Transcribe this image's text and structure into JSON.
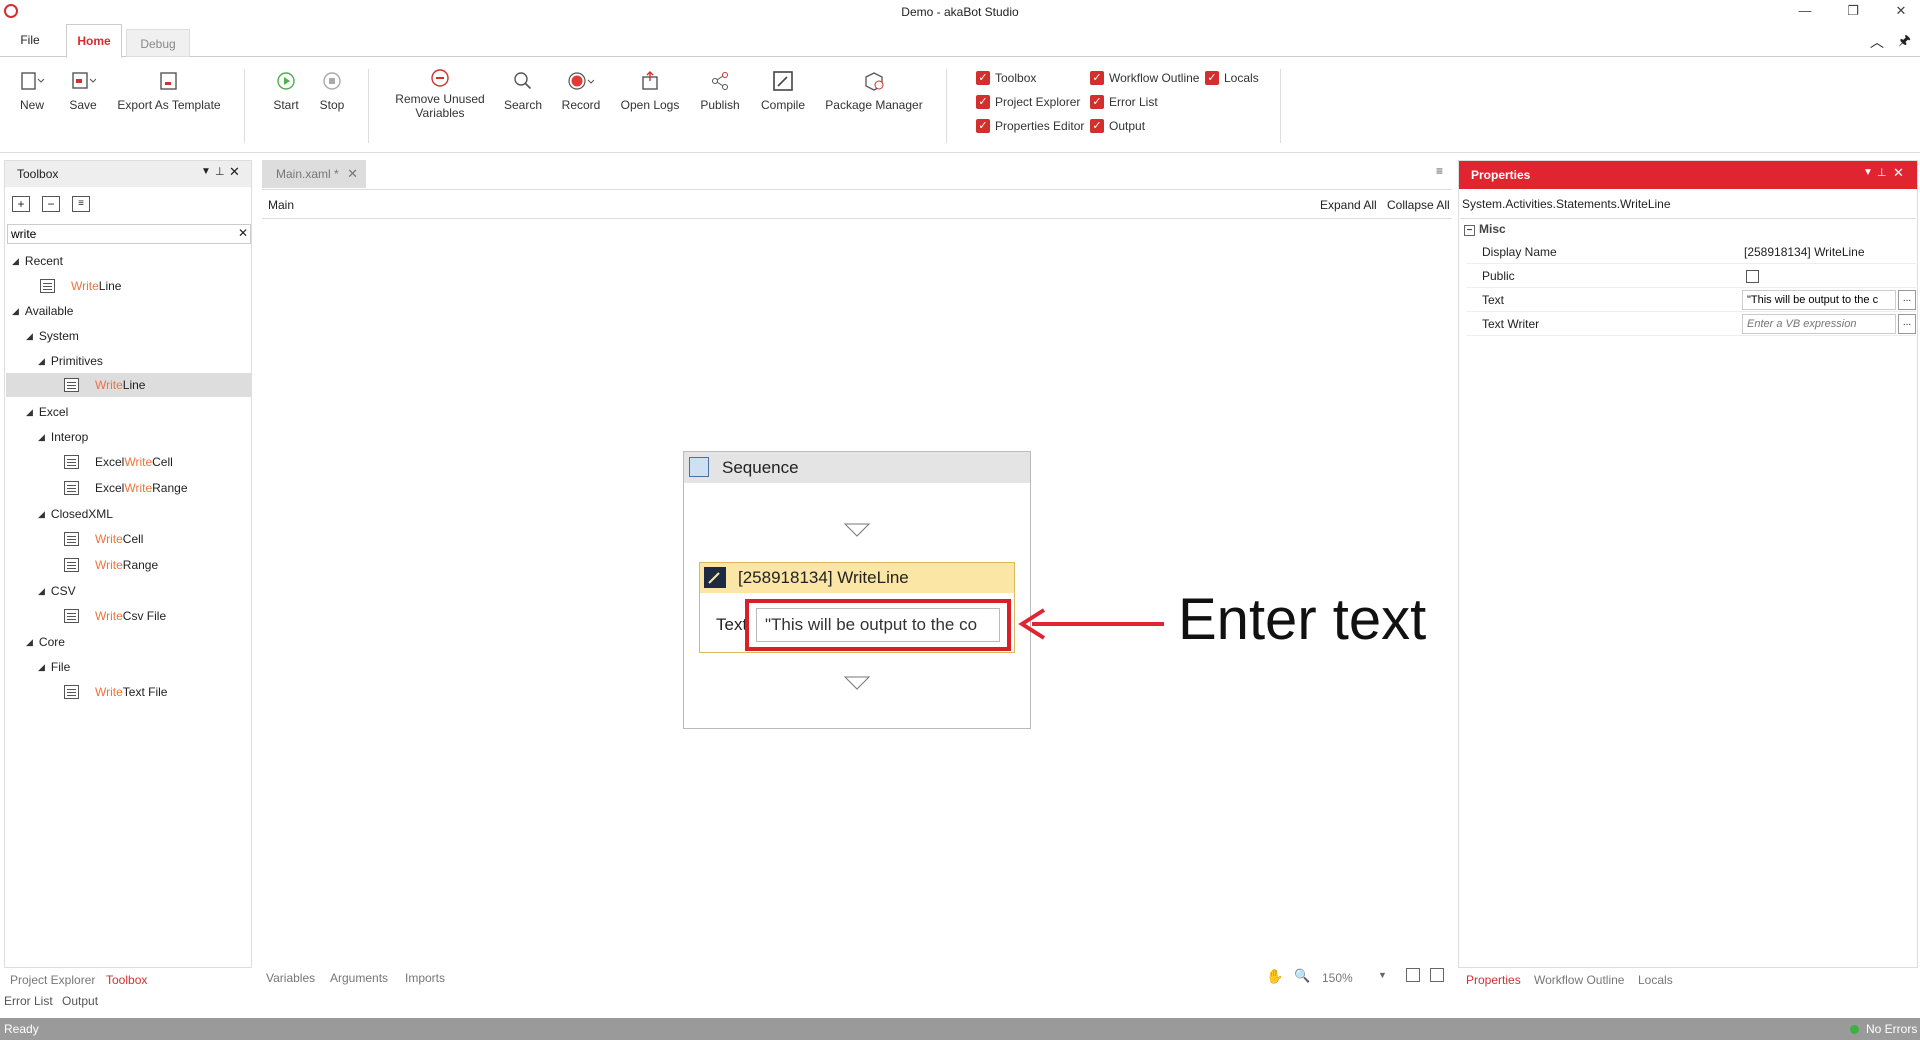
{
  "app": {
    "title": "Demo - akaBot Studio"
  },
  "menu_tabs": [
    "File",
    "Home",
    "Debug"
  ],
  "ribbon": {
    "new": "New",
    "save": "Save",
    "export_template": "Export As Template",
    "start": "Start",
    "stop": "Stop",
    "remove_unused_1": "Remove Unused",
    "remove_unused_2": "Variables",
    "search": "Search",
    "record": "Record",
    "open_logs": "Open Logs",
    "publish": "Publish",
    "compile": "Compile",
    "package_manager": "Package Manager"
  },
  "panels_toggle": {
    "toolbox": "Toolbox",
    "project_explorer": "Project Explorer",
    "properties_editor": "Properties Editor",
    "workflow_outline": "Workflow Outline",
    "error_list": "Error List",
    "output": "Output",
    "locals": "Locals"
  },
  "toolbox": {
    "title": "Toolbox",
    "search_value": "write",
    "recent": "Recent",
    "available": "Available",
    "system": "System",
    "primitives": "Primitives",
    "excel": "Excel",
    "interop": "Interop",
    "closedxml": "ClosedXML",
    "csv": "CSV",
    "core": "Core",
    "file": "File",
    "hl_write": "Write",
    "line": "Line",
    "excel_prefix": "Excel ",
    "cell": " Cell",
    "range": " Range",
    "csv_file": " Csv File",
    "text_file": " Text File"
  },
  "document": {
    "tab": "Main.xaml *",
    "breadcrumb": "Main",
    "expand_all": "Expand All",
    "collapse_all": "Collapse All",
    "sequence_title": "Sequence",
    "activity_title": "[258918134] WriteLine",
    "text_label": "Text",
    "text_value": "\"This will be output to the co",
    "callout": "Enter text"
  },
  "properties": {
    "title": "Properties",
    "type": "System.Activities.Statements.WriteLine",
    "category": "Misc",
    "display_name_label": "Display Name",
    "display_name_value": "[258918134] WriteLine",
    "public_label": "Public",
    "text_label": "Text",
    "text_value": "\"This will be output to the c",
    "text_writer_label": "Text Writer",
    "text_writer_placeholder": "Enter a VB expression",
    "ellipsis": "..."
  },
  "bottom_tabs": {
    "project_explorer": "Project Explorer",
    "toolbox": "Toolbox",
    "error_list": "Error List",
    "output": "Output",
    "variables": "Variables",
    "arguments": "Arguments",
    "imports": "Imports",
    "zoom": "150%",
    "properties": "Properties",
    "workflow_outline": "Workflow Outline",
    "locals": "Locals"
  },
  "status": {
    "left": "Ready",
    "right": "No Errors"
  },
  "colors": {
    "accent": "#d32f2f",
    "highlight": "#f0733a",
    "status_bar": "#9a9a9a"
  }
}
